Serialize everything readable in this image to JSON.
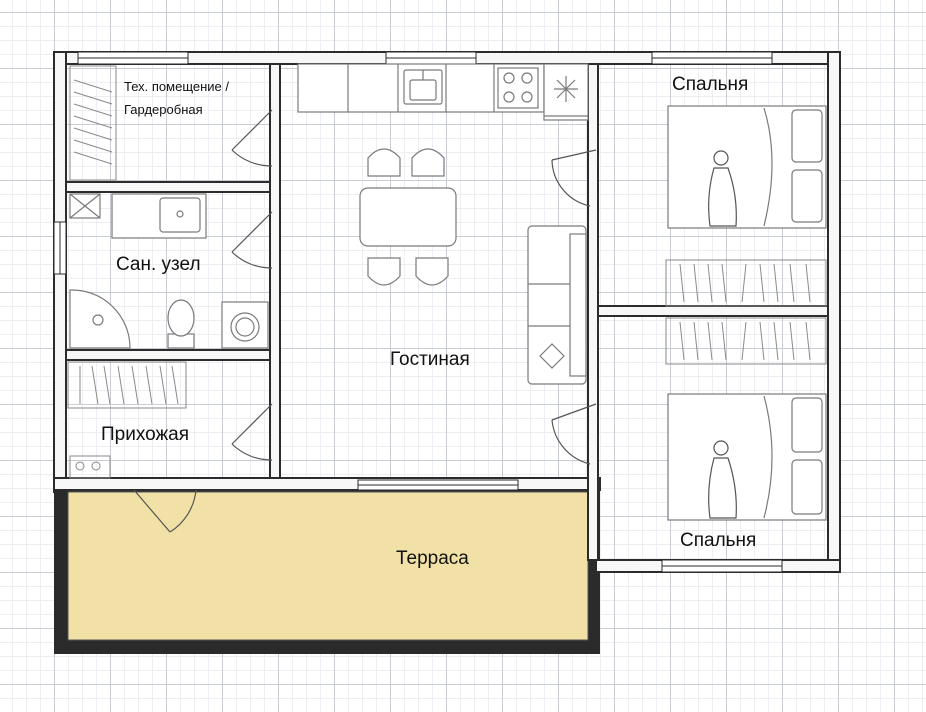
{
  "rooms": {
    "tech": {
      "line1": "Тех. помещение /",
      "line2": "Гардеробная"
    },
    "bathroom": "Сан. узел",
    "living": "Гостиная",
    "hallway": "Прихожая",
    "terrace": "Терраса",
    "bedroom_top": "Спальня",
    "bedroom_bottom": "Спальня"
  },
  "colors": {
    "wall": "#2b2b2b",
    "wall_fill": "#f7f7f7",
    "terrace_fill": "#f1e1a6",
    "furniture": "#8a8a8a",
    "grid": "#c9cdd3"
  },
  "furniture_icons": [
    "kitchen-counter",
    "sink-icon",
    "stove-icon",
    "fridge-icon",
    "dining-table",
    "chair-icon",
    "sofa-icon",
    "double-bed-icon",
    "wardrobe-icon",
    "shower-icon",
    "toilet-icon",
    "washing-machine-icon",
    "washbasin-icon",
    "door-icon",
    "window-icon",
    "person-figure-icon"
  ]
}
